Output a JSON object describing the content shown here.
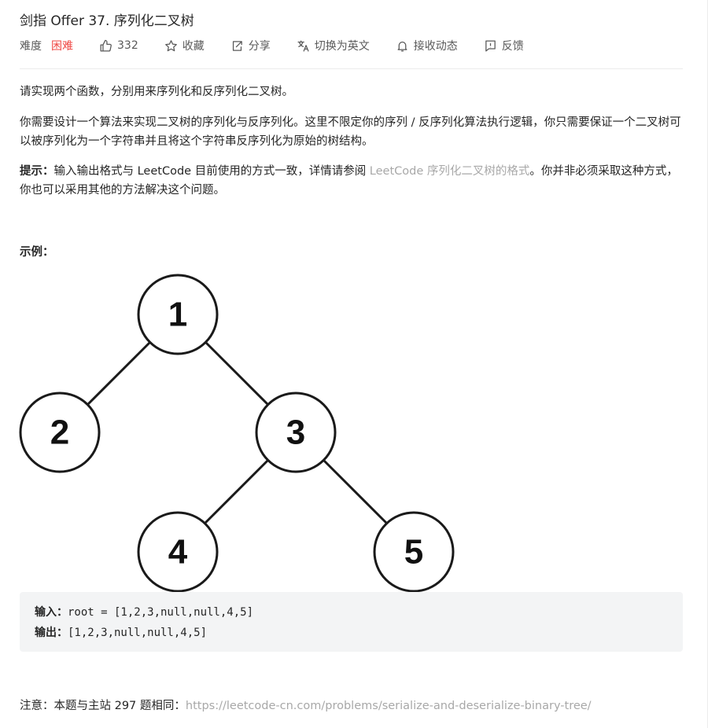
{
  "problem": {
    "title": "剑指 Offer 37. 序列化二叉树",
    "difficulty_label": "难度",
    "difficulty": "困难",
    "likes": "332",
    "actions": {
      "favorite": "收藏",
      "share": "分享",
      "switch_lang": "切换为英文",
      "follow": "接收动态",
      "feedback": "反馈"
    },
    "description_1": "请实现两个函数，分别用来序列化和反序列化二叉树。",
    "description_2": "你需要设计一个算法来实现二叉树的序列化与反序列化。这里不限定你的序列 / 反序列化算法执行逻辑，你只需要保证一个二叉树可以被序列化为一个字符串并且将这个字符串反序列化为原始的树结构。",
    "hint_label": "提示：",
    "hint_text_1": "输入输出格式与 LeetCode 目前使用的方式一致，详情请参阅 ",
    "hint_link": "LeetCode 序列化二叉树的格式",
    "hint_text_2": "。你并非必须采取这种方式，你也可以采用其他的方法解决这个问题。",
    "example_label": "示例：",
    "tree_nodes": [
      "1",
      "2",
      "3",
      "4",
      "5"
    ],
    "input_label": "输入：",
    "input_value": "root = [1,2,3,null,null,4,5]",
    "output_label": "输出：",
    "output_value": "[1,2,3,null,null,4,5]",
    "note_text": "注意：本题与主站 297 题相同：",
    "note_url": "https://leetcode-cn.com/problems/serialize-and-deserialize-binary-tree/"
  },
  "colors": {
    "difficulty_hard": "#ef4743",
    "link_gray": "#a8a8a8",
    "code_bg": "#f3f4f5",
    "text": "#262626"
  },
  "icons": [
    "thumbs-up-icon",
    "star-icon",
    "share-icon",
    "translate-icon",
    "bell-icon",
    "feedback-icon"
  ]
}
